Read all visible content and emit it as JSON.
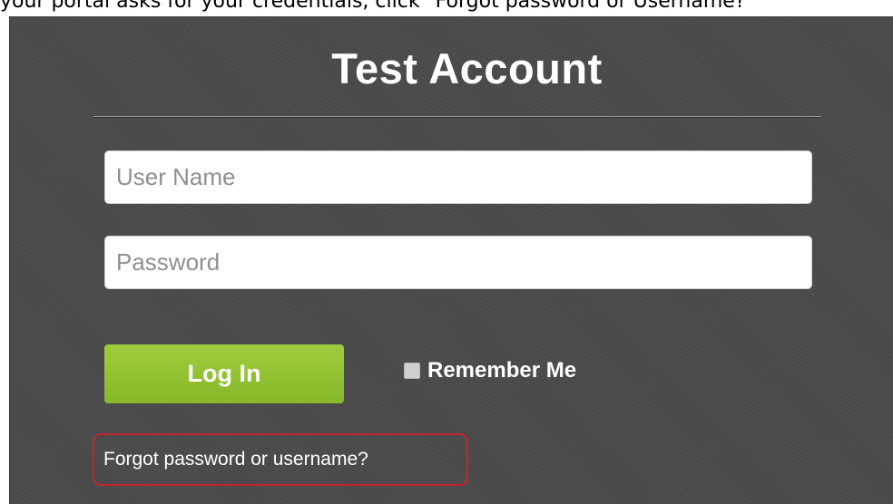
{
  "instruction": {
    "caption": "your portal asks for your credentials, click \"Forgot password or Username?\""
  },
  "login_panel": {
    "title": "Test Account",
    "username_placeholder": "User Name",
    "password_placeholder": "Password",
    "login_label": "Log In",
    "remember_label": "Remember Me",
    "remember_checked": false,
    "forgot_link": "Forgot password or username?"
  },
  "colors": {
    "panel_background": "#4a4a4a",
    "login_button": "#8fc031",
    "highlight_border": "#c0262e"
  }
}
